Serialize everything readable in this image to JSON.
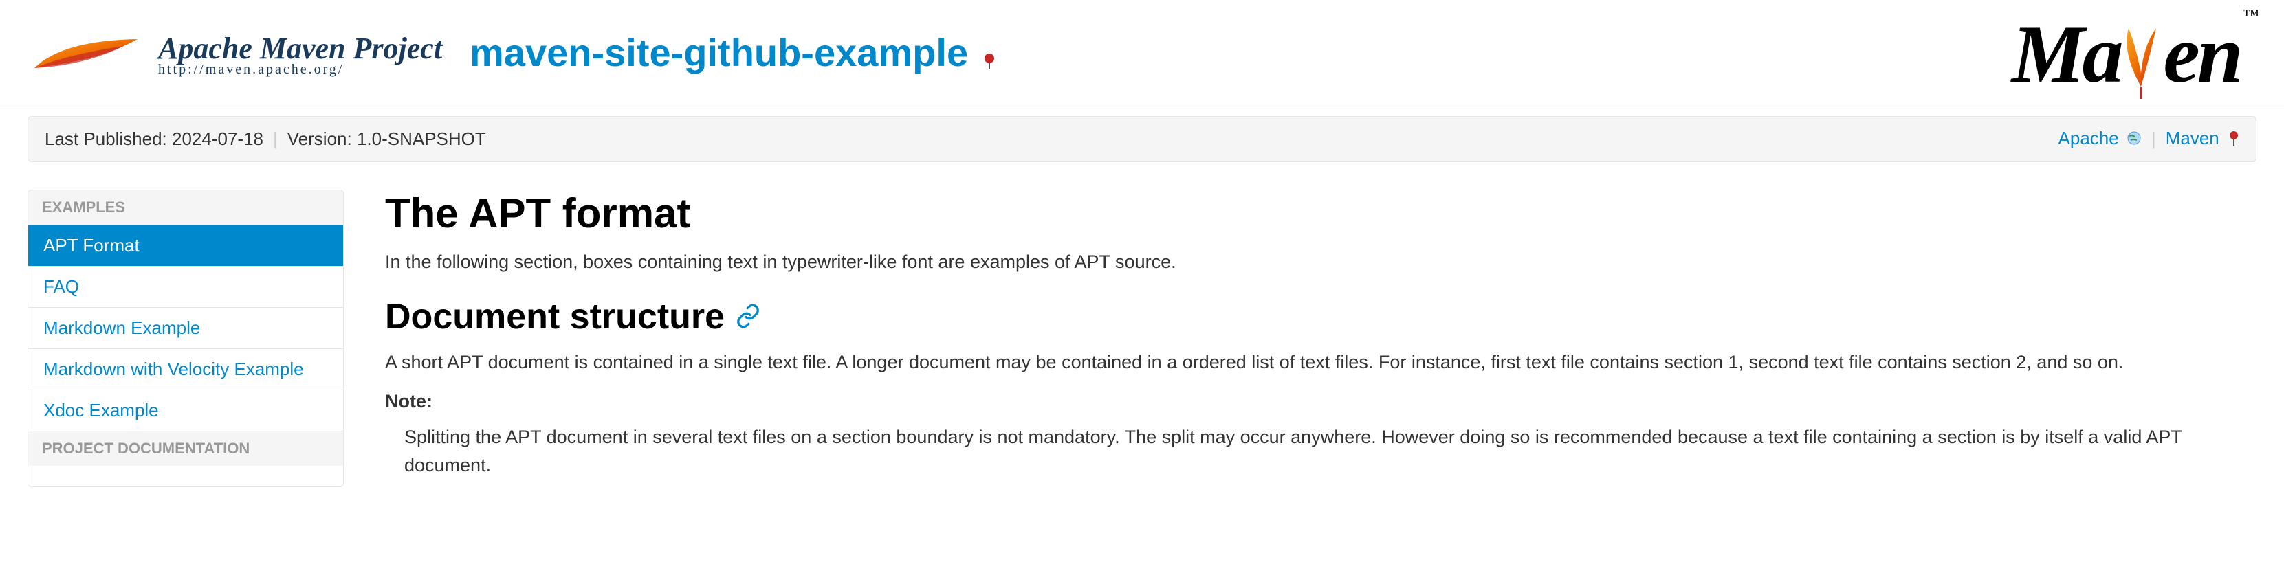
{
  "header": {
    "apache_title": "Apache Maven Project",
    "apache_url": "http://maven.apache.org/",
    "project_title": "maven-site-github-example",
    "maven_logo_text": "Maven"
  },
  "breadcrumb": {
    "last_published_label": "Last Published: 2024-07-18",
    "version_label": "Version: 1.0-SNAPSHOT",
    "links": [
      {
        "label": "Apache"
      },
      {
        "label": "Maven"
      }
    ]
  },
  "sidebar": {
    "sections": [
      {
        "header": "Examples",
        "items": [
          {
            "label": "APT Format",
            "active": true
          },
          {
            "label": "FAQ",
            "active": false
          },
          {
            "label": "Markdown Example",
            "active": false
          },
          {
            "label": "Markdown with Velocity Example",
            "active": false
          },
          {
            "label": "Xdoc Example",
            "active": false
          }
        ]
      },
      {
        "header": "Project Documentation",
        "items": []
      }
    ]
  },
  "content": {
    "h1": "The APT format",
    "intro": "In the following section, boxes containing text in typewriter-like font are examples of APT source.",
    "h2": "Document structure",
    "p1": "A short APT document is contained in a single text file. A longer document may be contained in a ordered list of text files. For instance, first text file contains section 1, second text file contains section 2, and so on.",
    "note_label": "Note:",
    "note_text": "Splitting the APT document in several text files on a section boundary is not mandatory. The split may occur anywhere. However doing so is recommended because a text file containing a section is by itself a valid APT document."
  }
}
